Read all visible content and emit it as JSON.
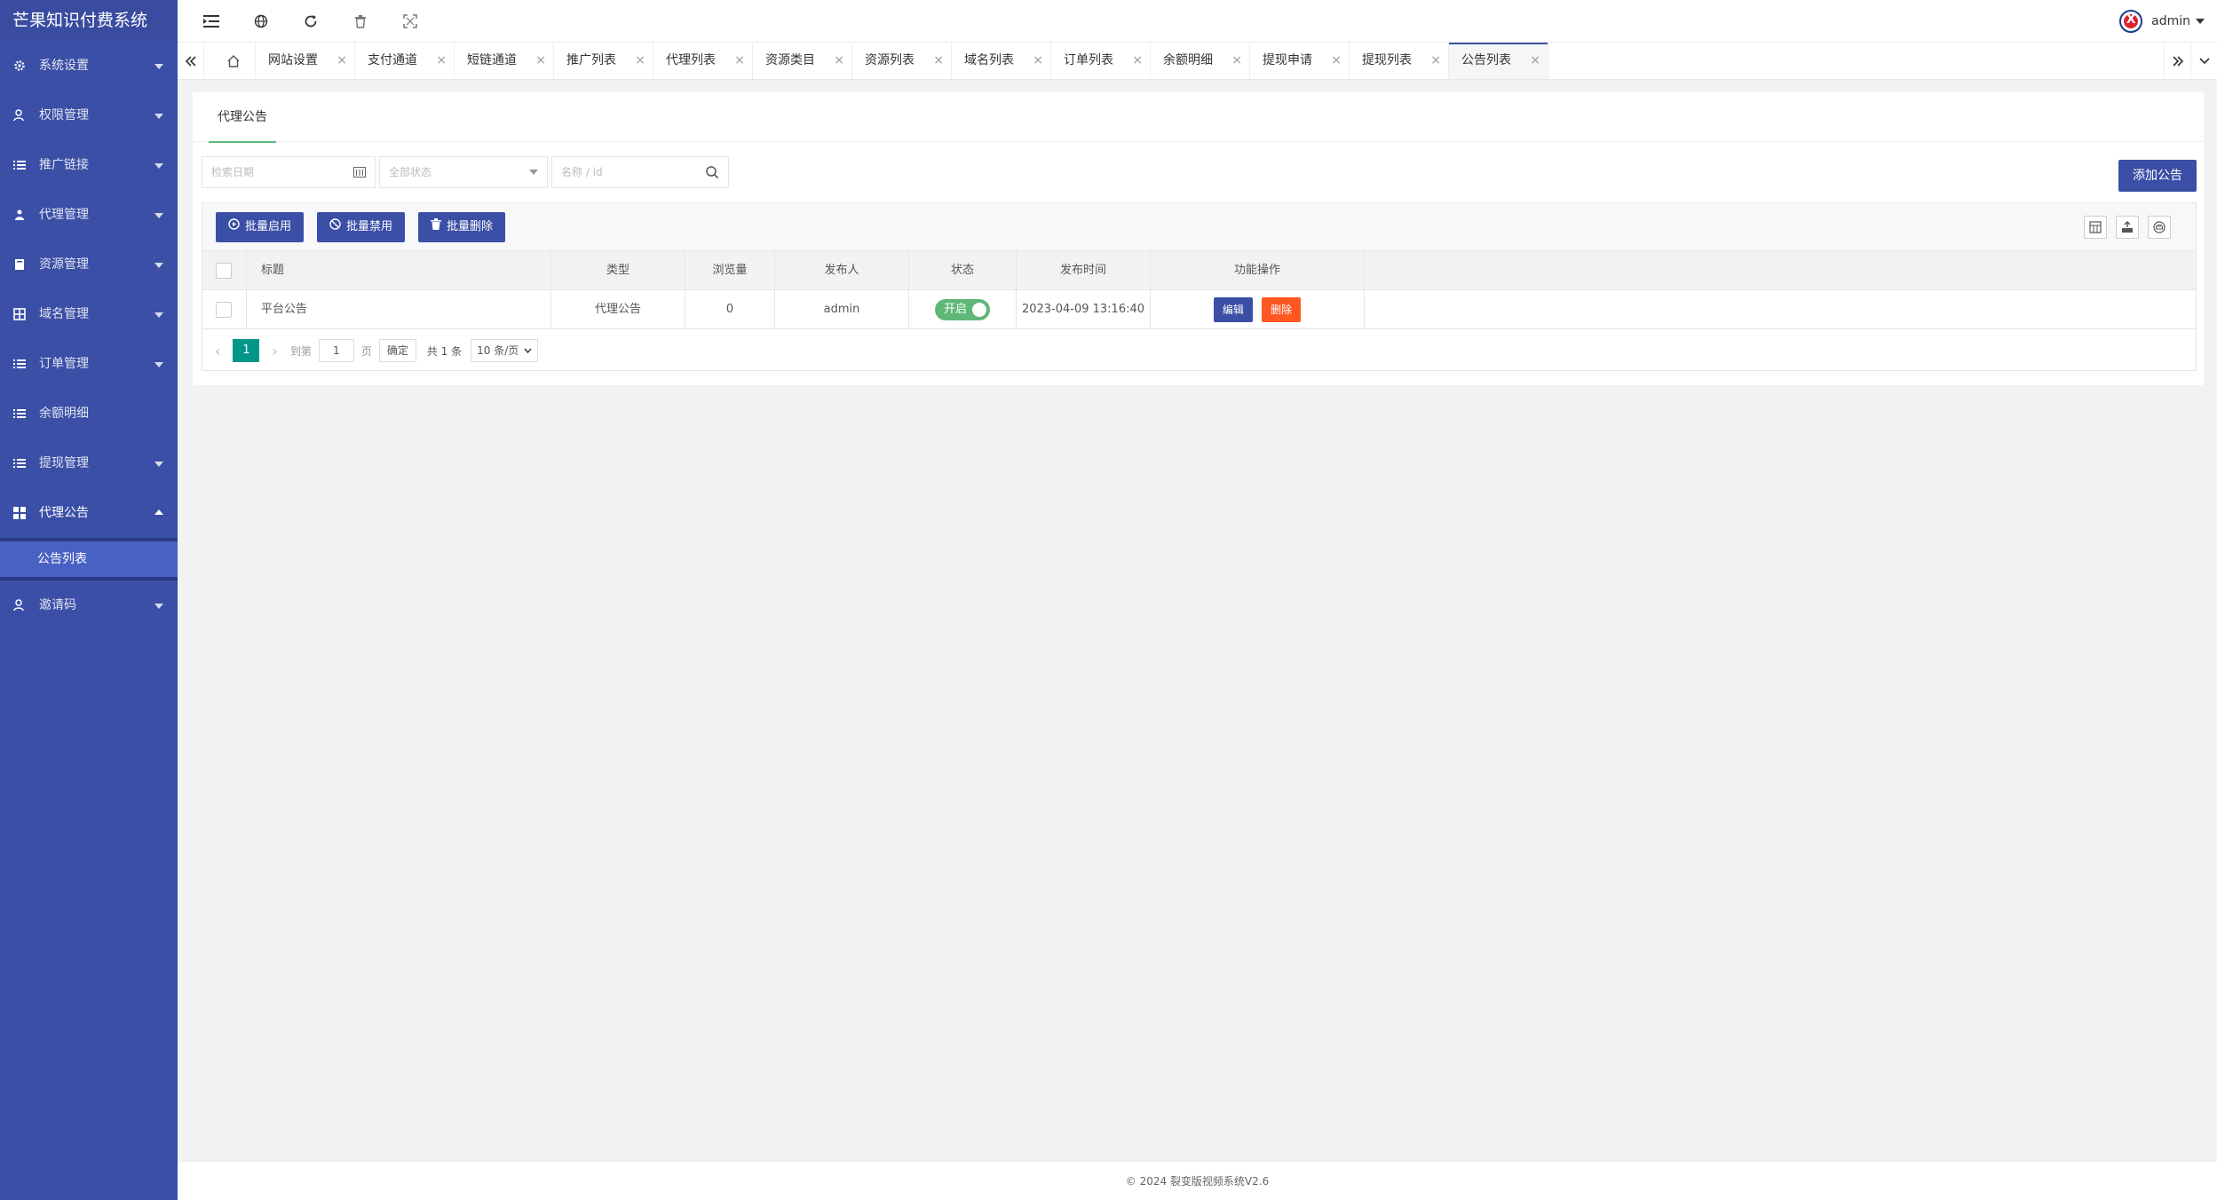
{
  "app": {
    "title": "芒果知识付费系统"
  },
  "sidebar": {
    "items": [
      {
        "label": "系统设置",
        "icon": "gear-icon",
        "expandable": true
      },
      {
        "label": "权限管理",
        "icon": "user-key-icon",
        "expandable": true
      },
      {
        "label": "推广链接",
        "icon": "list-icon",
        "expandable": true
      },
      {
        "label": "代理管理",
        "icon": "group-icon",
        "expandable": true
      },
      {
        "label": "资源管理",
        "icon": "book-icon",
        "expandable": true
      },
      {
        "label": "域名管理",
        "icon": "grid-icon",
        "expandable": true
      },
      {
        "label": "订单管理",
        "icon": "list-icon",
        "expandable": true
      },
      {
        "label": "余额明细",
        "icon": "list-icon",
        "expandable": false
      },
      {
        "label": "提现管理",
        "icon": "list-icon",
        "expandable": true
      },
      {
        "label": "代理公告",
        "icon": "dashboard-icon",
        "expandable": true,
        "open": true
      },
      {
        "label": "邀请码",
        "icon": "user-key-icon",
        "expandable": true
      }
    ],
    "submenu": {
      "parent": "代理公告",
      "items": [
        {
          "label": "公告列表",
          "active": true
        }
      ]
    }
  },
  "header": {
    "icons": [
      "menu-fold-icon",
      "globe-icon",
      "refresh-icon",
      "trash-icon",
      "fullscreen-icon"
    ],
    "user": "admin"
  },
  "tabs": {
    "items": [
      {
        "label": "网站设置"
      },
      {
        "label": "支付通道"
      },
      {
        "label": "短链通道"
      },
      {
        "label": "推广列表"
      },
      {
        "label": "代理列表"
      },
      {
        "label": "资源类目"
      },
      {
        "label": "资源列表"
      },
      {
        "label": "域名列表"
      },
      {
        "label": "订单列表"
      },
      {
        "label": "余额明细"
      },
      {
        "label": "提现申请"
      },
      {
        "label": "提现列表"
      },
      {
        "label": "公告列表",
        "active": true
      }
    ],
    "close_glyph": "×"
  },
  "page": {
    "card_tab": "代理公告",
    "filters": {
      "date_placeholder": "检索日期",
      "status_placeholder": "全部状态",
      "keyword_placeholder": "名称 / id"
    },
    "add_button": "添加公告",
    "toolbar": {
      "enable": "批量启用",
      "disable": "批量禁用",
      "delete": "批量删除"
    },
    "table": {
      "columns": [
        "标题",
        "类型",
        "浏览量",
        "发布人",
        "状态",
        "发布时间",
        "功能操作"
      ],
      "rows": [
        {
          "title": "平台公告",
          "type": "代理公告",
          "views": "0",
          "publisher": "admin",
          "status": "开启",
          "time": "2023-04-09 13:16:40",
          "edit": "编辑",
          "delete": "删除"
        }
      ]
    },
    "pager": {
      "current": "1",
      "goto_label": "到第",
      "goto_value": "1",
      "page_unit": "页",
      "confirm": "确定",
      "total": "共 1 条",
      "page_size": "10 条/页"
    }
  },
  "footer": {
    "text": "© 2024 裂变版视频系统V2.6"
  },
  "colors": {
    "sidebar": "#3b4fa6",
    "primary": "#3b4fa6",
    "switch_on": "#5fb878",
    "danger": "#ff5722",
    "pager_current": "#009688"
  }
}
